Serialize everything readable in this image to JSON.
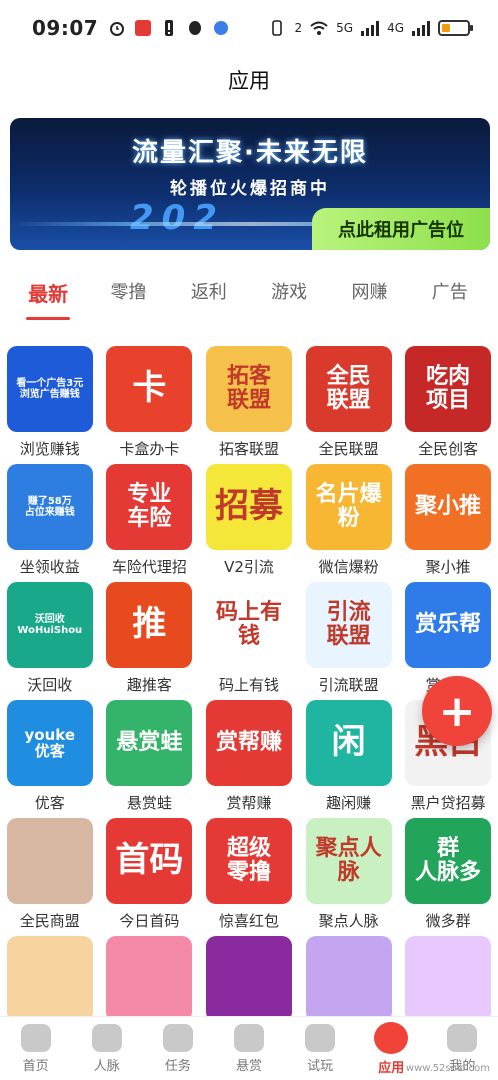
{
  "status_bar": {
    "time": "09:07",
    "sim2": "5G",
    "sim1": "4G",
    "wifi_badge": "2",
    "battery_level": 0.3
  },
  "header": {
    "title": "应用"
  },
  "banner": {
    "headline": "流量汇聚·未来无限",
    "subline": "轮播位火爆招商中",
    "year": "202",
    "cta": "点此租用广告位"
  },
  "tabs": [
    {
      "label": "最新",
      "active": true
    },
    {
      "label": "零撸",
      "active": false
    },
    {
      "label": "返利",
      "active": false
    },
    {
      "label": "游戏",
      "active": false
    },
    {
      "label": "网赚",
      "active": false
    },
    {
      "label": "广告",
      "active": false
    }
  ],
  "apps": [
    {
      "label": "浏览赚钱",
      "icon_text": "看一个广告3元\n浏览广告赚钱",
      "color": "#1e5bd8"
    },
    {
      "label": "卡盒办卡",
      "icon_text": "卡",
      "color": "#e8412c"
    },
    {
      "label": "拓客联盟",
      "icon_text": "拓客\n联盟",
      "color": "#f6c14b"
    },
    {
      "label": "全民联盟",
      "icon_text": "全民\n联盟",
      "color": "#d93a2b"
    },
    {
      "label": "全民创客",
      "icon_text": "吃肉\n项目",
      "color": "#c62828"
    },
    {
      "label": "坐领收益",
      "icon_text": "赚了58万\n占位来赚钱",
      "color": "#2d7ee0"
    },
    {
      "label": "车险代理招",
      "icon_text": "专业\n车险",
      "color": "#e53935"
    },
    {
      "label": "V2引流",
      "icon_text": "招募",
      "color": "#f5e63a"
    },
    {
      "label": "微信爆粉",
      "icon_text": "名片爆粉",
      "color": "#f7b733"
    },
    {
      "label": "聚小推",
      "icon_text": "聚小推",
      "color": "#f27023"
    },
    {
      "label": "沃回收",
      "icon_text": "沃回收\nWoHuiShou",
      "color": "#19a98a"
    },
    {
      "label": "趣推客",
      "icon_text": "推",
      "color": "#e84a1f"
    },
    {
      "label": "码上有钱",
      "icon_text": "码上有钱",
      "color": "#ffffff"
    },
    {
      "label": "引流联盟",
      "icon_text": "引流\n联盟",
      "color": "#e8f4ff"
    },
    {
      "label": "赏乐帮",
      "icon_text": "赏乐帮",
      "color": "#2f7be9"
    },
    {
      "label": "优客",
      "icon_text": "youke\n优客",
      "color": "#1f8de0"
    },
    {
      "label": "悬赏蛙",
      "icon_text": "悬赏蛙",
      "color": "#34b36a"
    },
    {
      "label": "赏帮赚",
      "icon_text": "赏帮赚",
      "color": "#e53935"
    },
    {
      "label": "趣闲赚",
      "icon_text": "闲",
      "color": "#1fb5a0"
    },
    {
      "label": "黑户贷招募",
      "icon_text": "黑白",
      "color": "#f2f2f2"
    },
    {
      "label": "全民商盟",
      "icon_text": "",
      "color": "#d8b7a2"
    },
    {
      "label": "今日首码",
      "icon_text": "首码",
      "color": "#e53935"
    },
    {
      "label": "惊喜红包",
      "icon_text": "超级\n零撸",
      "color": "#e53935"
    },
    {
      "label": "聚点人脉",
      "icon_text": "聚点人脉",
      "color": "#c8f0c0"
    },
    {
      "label": "微多群",
      "icon_text": "群\n人脉多",
      "color": "#22a45a"
    },
    {
      "label": "",
      "icon_text": "",
      "color": "#f7d3a0"
    },
    {
      "label": "",
      "icon_text": "",
      "color": "#f48aa8"
    },
    {
      "label": "",
      "icon_text": "",
      "color": "#8a2a9f"
    },
    {
      "label": "",
      "icon_text": "",
      "color": "#c4a6f0"
    },
    {
      "label": "",
      "icon_text": "",
      "color": "#e8c8ff"
    }
  ],
  "fab": {
    "label": "+"
  },
  "bottom_nav": [
    {
      "label": "首页",
      "active": false
    },
    {
      "label": "人脉",
      "active": false
    },
    {
      "label": "任务",
      "active": false
    },
    {
      "label": "悬赏",
      "active": false
    },
    {
      "label": "试玩",
      "active": false
    },
    {
      "label": "应用",
      "active": true
    },
    {
      "label": "我的",
      "active": false
    }
  ],
  "watermark": "www.52solo.com",
  "colors": {
    "accent": "#e53935"
  }
}
